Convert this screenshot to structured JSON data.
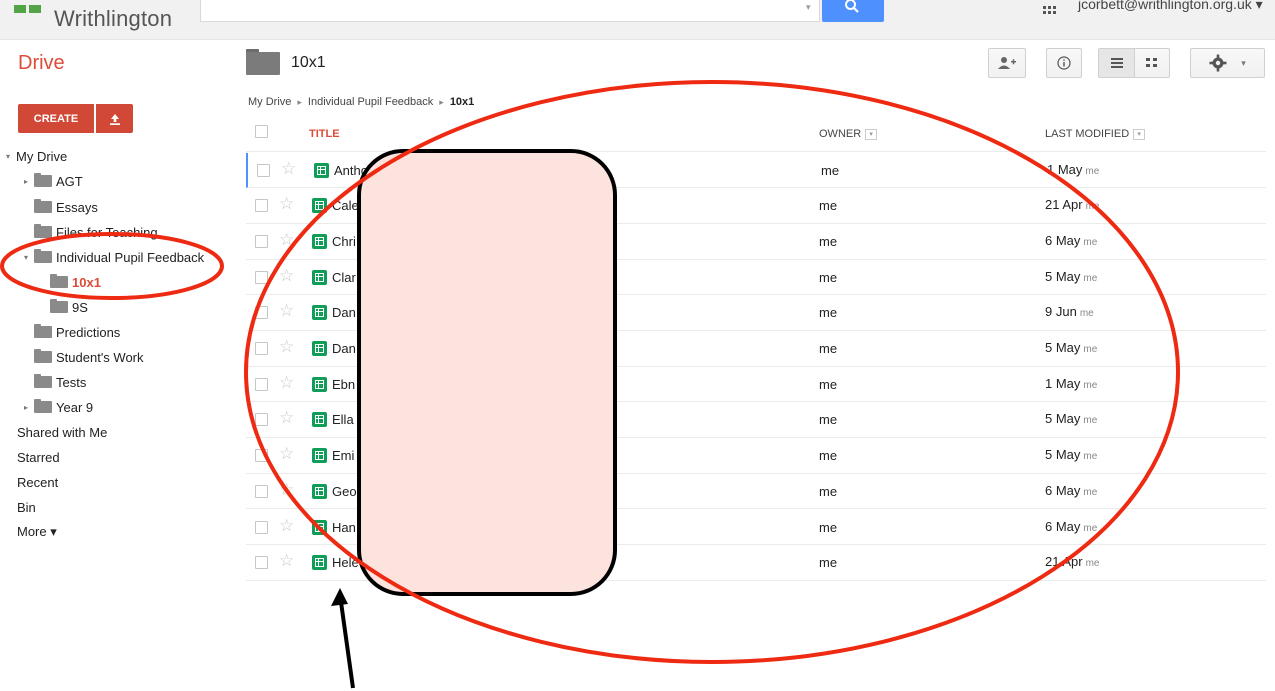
{
  "topbar": {
    "logo_text": "Writhlington",
    "account": "jcorbett@writhlington.org.uk ▾"
  },
  "header": {
    "app_title": "Drive",
    "folder_name": "10x1"
  },
  "sidebar": {
    "create_label": "CREATE",
    "items": [
      {
        "label": "My Drive",
        "arrow": "▾"
      },
      {
        "label": "AGT",
        "arrow": "▸"
      },
      {
        "label": "Essays"
      },
      {
        "label": "Files for Teaching"
      },
      {
        "label": "Individual Pupil Feedback",
        "arrow": "▾"
      },
      {
        "label": "10x1"
      },
      {
        "label": "9S"
      },
      {
        "label": "Predictions"
      },
      {
        "label": "Student's Work"
      },
      {
        "label": "Tests"
      },
      {
        "label": "Year 9",
        "arrow": "▸"
      },
      {
        "label": "Shared with Me"
      },
      {
        "label": "Starred"
      },
      {
        "label": "Recent"
      },
      {
        "label": "Bin"
      },
      {
        "label": "More ▾"
      }
    ]
  },
  "breadcrumb": {
    "items": [
      "My Drive",
      "Individual Pupil Feedback",
      "10x1"
    ],
    "separator": "▸"
  },
  "table": {
    "headers": {
      "title": "TITLE",
      "owner": "OWNER",
      "last_modified": "LAST MODIFIED"
    },
    "rows": [
      {
        "name": "Antho",
        "owner": "me",
        "date": "1 May",
        "by": "me"
      },
      {
        "name": "Cale",
        "owner": "me",
        "date": "21 Apr",
        "by": "me"
      },
      {
        "name": "Chri",
        "owner": "me",
        "date": "6 May",
        "by": "me"
      },
      {
        "name": "Clar",
        "owner": "me",
        "date": "5 May",
        "by": "me"
      },
      {
        "name": "Dan",
        "owner": "me",
        "date": "9 Jun",
        "by": "me"
      },
      {
        "name": "Dan",
        "owner": "me",
        "date": "5 May",
        "by": "me"
      },
      {
        "name": "Ebn",
        "owner": "me",
        "date": "1 May",
        "by": "me"
      },
      {
        "name": "Ella",
        "owner": "me",
        "date": "5 May",
        "by": "me"
      },
      {
        "name": "Emi",
        "owner": "me",
        "date": "5 May",
        "by": "me"
      },
      {
        "name": "Geo",
        "owner": "me",
        "date": "6 May",
        "by": "me"
      },
      {
        "name": "Han",
        "owner": "me",
        "date": "6 May",
        "by": "me"
      },
      {
        "name": "Hele",
        "owner": "me",
        "date": "21 Apr",
        "by": "me"
      }
    ]
  },
  "icons": {
    "search": "search-icon",
    "apps": "apps-grid-icon",
    "share": "add-person-icon",
    "info": "info-icon",
    "list": "list-view-icon",
    "grid": "grid-view-icon",
    "settings": "gear-icon",
    "upload": "upload-icon",
    "folder": "folder-icon",
    "sheet": "spreadsheet-icon",
    "star": "star-icon"
  },
  "colors": {
    "brand_red": "#dd4b39",
    "create_red": "#d14836",
    "search_blue": "#4d90fe",
    "sheet_green": "#0f9d58",
    "annotation_red": "#ee2a12",
    "redaction_fill": "#fde3de"
  }
}
